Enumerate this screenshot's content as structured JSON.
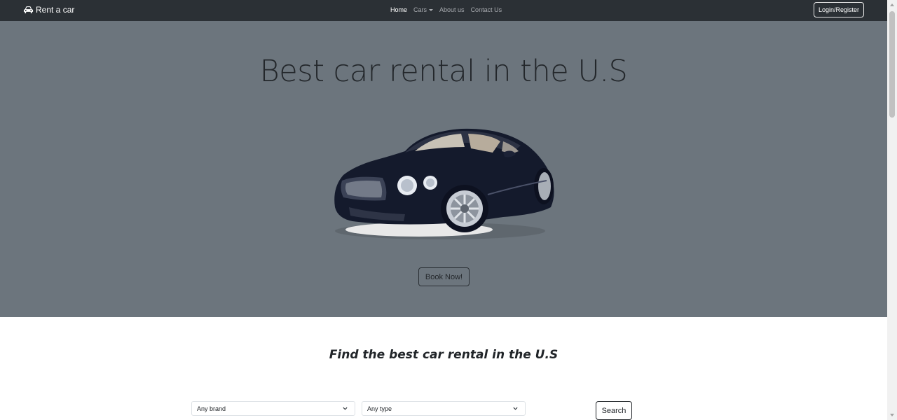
{
  "navbar": {
    "brand_label": "Rent a car",
    "brand_icon": "car-icon",
    "links": [
      {
        "label": "Home",
        "active": true
      },
      {
        "label": "Cars",
        "dropdown": true
      },
      {
        "label": "About us"
      },
      {
        "label": "Contact Us"
      }
    ],
    "login_label": "Login/Register"
  },
  "hero": {
    "title": "Best car rental in the U.S",
    "image": "car-image",
    "book_label": "Book Now!"
  },
  "search": {
    "title": "Find the best car rental in the U.S",
    "brand_select": "Any brand",
    "type_select": "Any type",
    "search_label": "Search"
  },
  "colors": {
    "navbar_bg": "#2b3035",
    "hero_bg": "#6c757d",
    "text_dark": "#212529"
  }
}
